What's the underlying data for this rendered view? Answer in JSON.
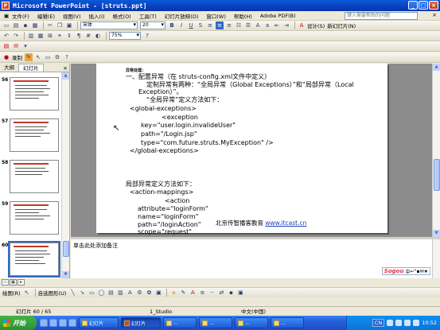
{
  "window": {
    "title": "Microsoft PowerPoint - [struts.ppt]",
    "app_icon": "P",
    "controls": [
      "_",
      "□",
      "×"
    ]
  },
  "menu": {
    "items": [
      "文件(F)",
      "编辑(E)",
      "视图(V)",
      "插入(I)",
      "格式(O)",
      "工具(T)",
      "幻灯片放映(D)",
      "窗口(W)",
      "帮助(H)",
      "Adobe PDF(B)"
    ],
    "help_placeholder": "键入需要帮助的问题",
    "close": "×"
  },
  "toolbar_format": {
    "font_name": "宋体",
    "font_size": "20",
    "bold": "B",
    "italic": "I",
    "underline": "U",
    "shadow": "S",
    "design_label": "设计(S)",
    "new_slide_label": "新幻灯片(N)"
  },
  "toolbar_standard": {
    "zoom": "75%"
  },
  "toolbar_record": {
    "record_label": "录制"
  },
  "panel": {
    "tabs": [
      "大纲",
      "幻灯片"
    ],
    "close": "×",
    "slides": [
      {
        "num": "56"
      },
      {
        "num": "57"
      },
      {
        "num": "58"
      },
      {
        "num": "59"
      },
      {
        "num": "60",
        "selected": true
      }
    ]
  },
  "slide": {
    "small_heading": "异常处理：",
    "lines": [
      "一、配置异常（在 struts-config.xml文件中定义）",
      "定制异常有两种：“全局异常（Global Exceptions）”和“局部异常（Local",
      "Exception）”。",
      "“全局异常”定义方法如下：",
      "<global-exceptions>",
      "<exception",
      "key=\"user.login.invalideUser\"",
      "path=\"/Login.jsp\"",
      "type=\"com.future.struts.MyException\" />",
      "</global-exceptions>",
      "局部异常定义方法如下：",
      "<action-mappings>",
      "<action",
      "attribute=\"loginForm\"",
      "name=\"loginForm\"",
      "path=\"/loginAction\"",
      "scope=\"request\""
    ],
    "footer_text": "北京传智播客教育",
    "footer_link": "www.itcast.cn"
  },
  "notes": {
    "placeholder": "单击此处添加备注"
  },
  "ime": {
    "logo": "Sogou",
    "labels": [
      "中",
      "↵",
      "°",
      "▪",
      "✉",
      "★"
    ]
  },
  "drawbar": {
    "draw_label": "绘图(R)",
    "autoshape_label": "自选图形(U)"
  },
  "status": {
    "slide_counter": "幻灯片 60 / 65",
    "design": "1_Studio",
    "language": "中文(中国)"
  },
  "taskbar": {
    "start_label": "开始",
    "tasks": [
      "幻灯片",
      "幻灯片",
      "...",
      "...",
      "...",
      "..."
    ],
    "lang": "CN",
    "clock": "10:52"
  },
  "colors": {
    "title_gradient": "#0a3fc0",
    "taskbar": "#245edb",
    "start": "#36a53a",
    "link": "#1a3fb0"
  }
}
